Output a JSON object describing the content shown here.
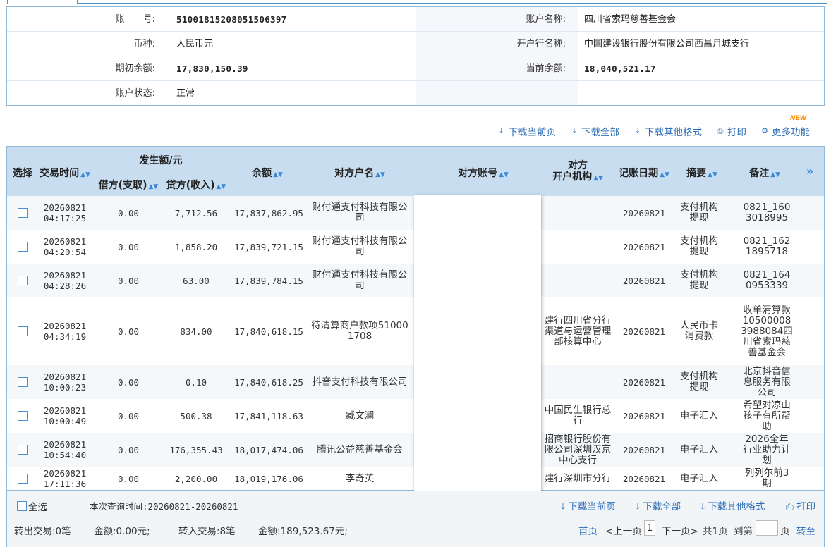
{
  "account": {
    "no_label": "账　　号:",
    "no_value": "51001815208051506397",
    "name_label": "账户名称:",
    "name_value": "四川省索玛慈善基金会",
    "currency_label": "币种:",
    "currency_value": "人民币元",
    "bank_label": "开户行名称:",
    "bank_value": "中国建设银行股份有限公司西昌月城支行",
    "opening_label": "期初余额:",
    "opening_value": "17,830,150.39",
    "current_label": "当前余额:",
    "current_value": "18,040,521.17",
    "status_label": "账户状态:",
    "status_value": "正常"
  },
  "toolbar": {
    "new_badge": "NEW",
    "download_page": "下载当前页",
    "download_all": "下载全部",
    "download_other": "下载其他格式",
    "print": "打印",
    "more": "更多功能"
  },
  "table": {
    "headers": {
      "select": "选择",
      "time": "交易时间",
      "amount_group": "发生额/元",
      "debit": "借方(支取)",
      "credit": "贷方(收入)",
      "balance": "余额",
      "counter_name": "对方户名",
      "counter_account": "对方账号",
      "counter_bank_1": "对方",
      "counter_bank_2": "开户机构",
      "post_date": "记账日期",
      "summary": "摘要",
      "remark": "备注",
      "more_cols": "»"
    },
    "rows": [
      {
        "date": "20260821",
        "time": "04:17:25",
        "debit": "0.00",
        "credit": "7,712.56",
        "balance": "17,837,862.95",
        "name": "财付通支付科技有限公司",
        "bank": "",
        "post": "20260821",
        "summary": "支付机构提现",
        "remark": "0821_1603018995"
      },
      {
        "date": "20260821",
        "time": "04:20:54",
        "debit": "0.00",
        "credit": "1,858.20",
        "balance": "17,839,721.15",
        "name": "财付通支付科技有限公司",
        "bank": "",
        "post": "20260821",
        "summary": "支付机构提现",
        "remark": "0821_1621895718"
      },
      {
        "date": "20260821",
        "time": "04:28:26",
        "debit": "0.00",
        "credit": "63.00",
        "balance": "17,839,784.15",
        "name": "财付通支付科技有限公司",
        "bank": "",
        "post": "20260821",
        "summary": "支付机构提现",
        "remark": "0821_1640953339"
      },
      {
        "date": "20260821",
        "time": "04:34:19",
        "debit": "0.00",
        "credit": "834.00",
        "balance": "17,840,618.15",
        "name": "待清算商户款项510001708",
        "bank": "建行四川省分行渠道与运营管理部核算中心",
        "post": "20260821",
        "summary": "人民币卡消费款",
        "remark": "收单清算款105000083988084四川省索玛慈善基金会"
      },
      {
        "date": "20260821",
        "time": "10:00:23",
        "debit": "0.00",
        "credit": "0.10",
        "balance": "17,840,618.25",
        "name": "抖音支付科技有限公司",
        "bank": "",
        "post": "20260821",
        "summary": "支付机构提现",
        "remark": "北京抖音信息服务有限公司"
      },
      {
        "date": "20260821",
        "time": "10:00:49",
        "debit": "0.00",
        "credit": "500.38",
        "balance": "17,841,118.63",
        "name": "臧文澜",
        "bank": "中国民生银行总行",
        "post": "20260821",
        "summary": "电子汇入",
        "remark": "希望对凉山孩子有所帮助"
      },
      {
        "date": "20260821",
        "time": "10:54:40",
        "debit": "0.00",
        "credit": "176,355.43",
        "balance": "18,017,474.06",
        "name": "腾讯公益慈善基金会",
        "bank": "招商银行股份有限公司深圳汉京中心支行",
        "post": "20260821",
        "summary": "电子汇入",
        "remark": "2026全年行业助力计划"
      },
      {
        "date": "20260821",
        "time": "17:11:36",
        "debit": "0.00",
        "credit": "2,200.00",
        "balance": "18,019,176.06",
        "name": "李奇英",
        "bank": "建行深圳市分行",
        "post": "20260821",
        "summary": "电子汇入",
        "remark": "列列尔前3期"
      }
    ]
  },
  "footer": {
    "select_all": "全选",
    "query_time": "本次查询时间:20260821-20260821",
    "download_page": "下载当前页",
    "download_all": "下载全部",
    "download_other": "下载其他格式",
    "print": "打印",
    "out_tx": "转出交易:0笔",
    "out_amount": "金额:0.00元;",
    "in_tx": "转入交易:8笔",
    "in_amount": "金额:189,523.67元;",
    "first": "首页",
    "prev": "<上一页",
    "page": "1",
    "next": "下一页>",
    "total": "共1页",
    "goto_label": "到第",
    "goto_unit": "页",
    "goto_btn": "转至"
  }
}
